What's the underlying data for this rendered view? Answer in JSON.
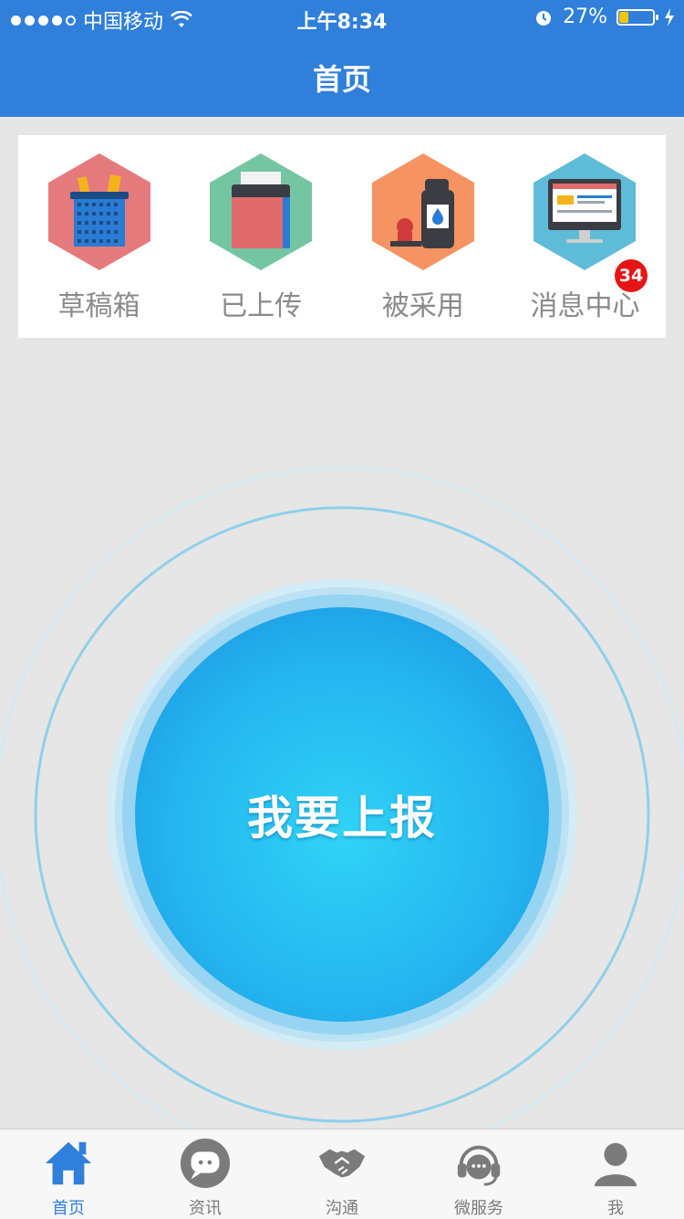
{
  "status_bar": {
    "carrier": "中国移动",
    "time": "上午8:34",
    "battery": "27%",
    "battery_level": 0.27
  },
  "header": {
    "title": "首页"
  },
  "quick_entries": [
    {
      "label": "草稿箱",
      "icon": "basket-icon"
    },
    {
      "label": "已上传",
      "icon": "printer-icon"
    },
    {
      "label": "被采用",
      "icon": "stamp-icon"
    },
    {
      "label": "消息中心",
      "icon": "monitor-icon",
      "badge": "34"
    }
  ],
  "report_button": {
    "label": "我要上报"
  },
  "tabbar": [
    {
      "label": "首页",
      "icon": "home-icon",
      "active": true
    },
    {
      "label": "资讯",
      "icon": "chat-icon",
      "active": false
    },
    {
      "label": "沟通",
      "icon": "handshake-icon",
      "active": false
    },
    {
      "label": "微服务",
      "icon": "headset-icon",
      "active": false
    },
    {
      "label": "我",
      "icon": "user-icon",
      "active": false
    }
  ],
  "colors": {
    "brand": "#2f7fdb",
    "badge": "#e61515"
  }
}
